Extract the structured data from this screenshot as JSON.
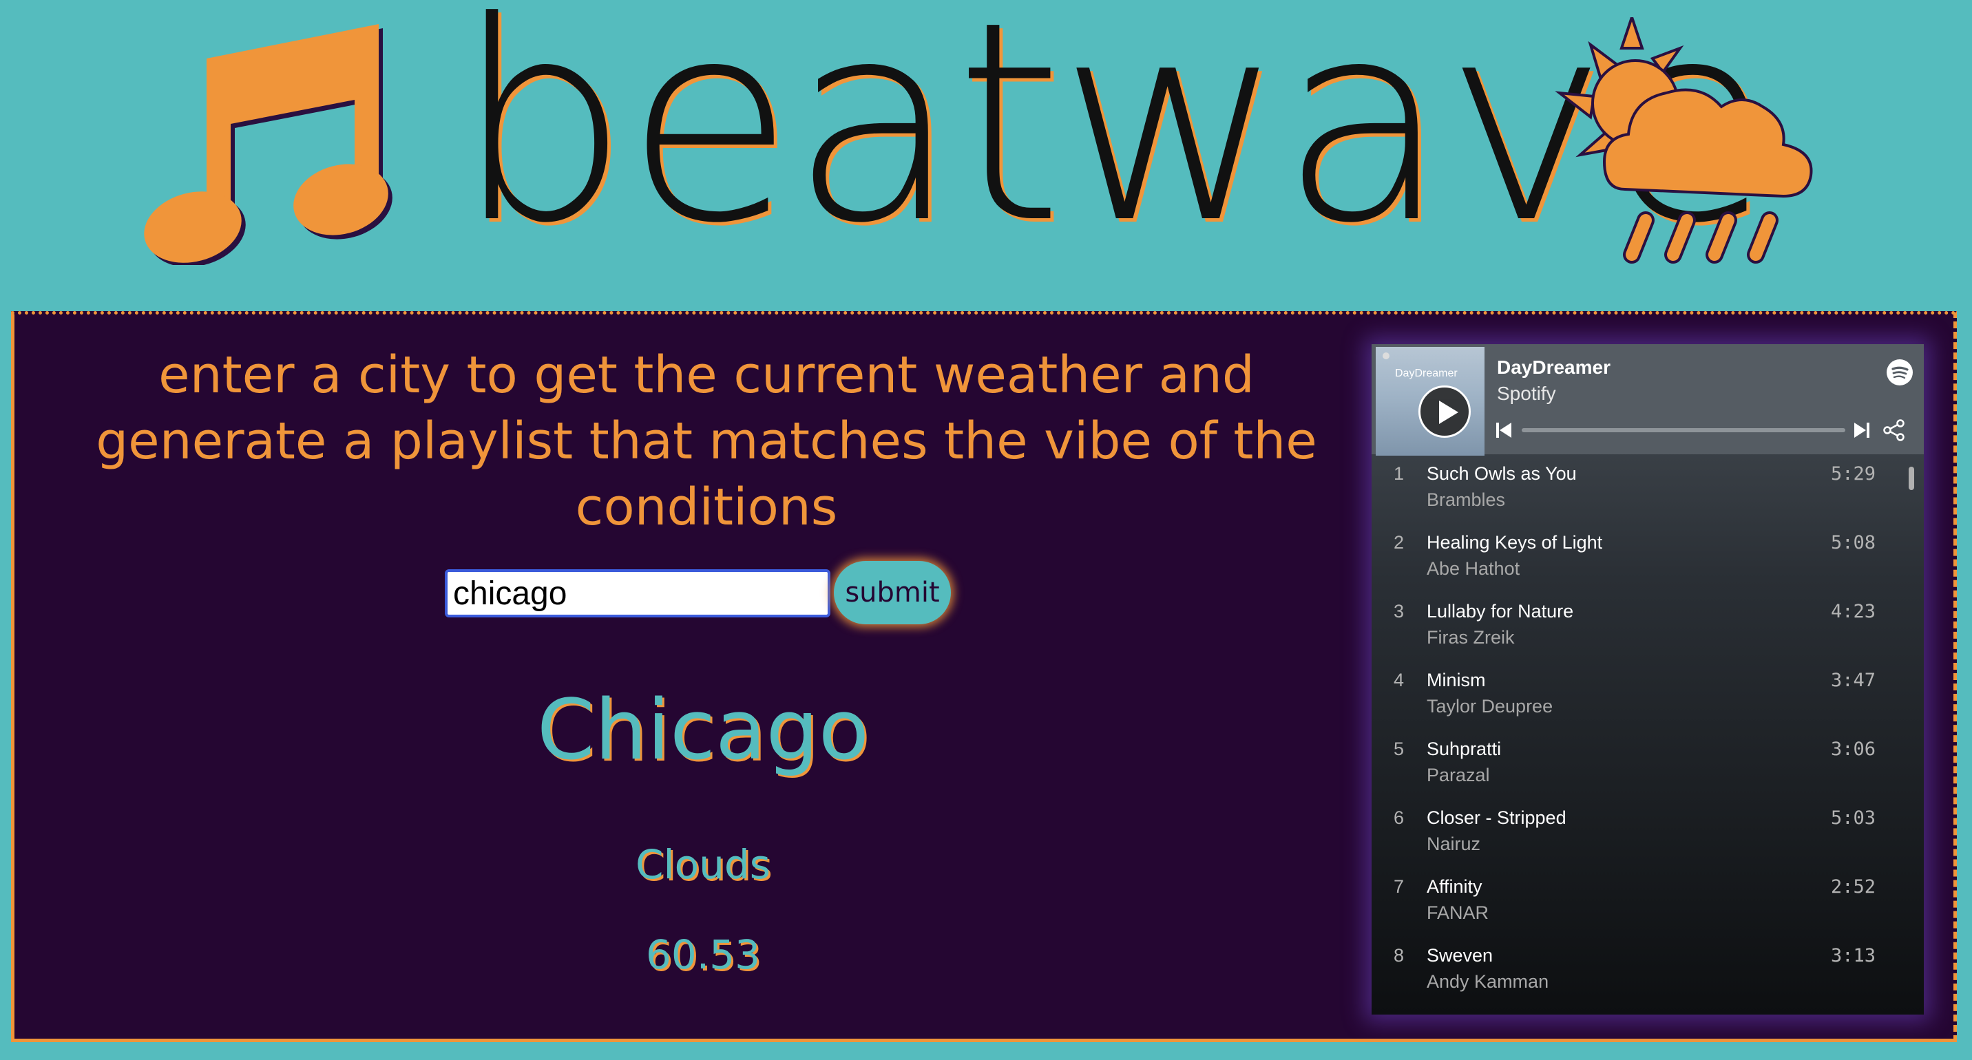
{
  "brand": {
    "name": "beatwave"
  },
  "icons": {
    "logo_left": "music-note-icon",
    "logo_right": "sun-cloud-rain-icon"
  },
  "colors": {
    "background": "#55bcbe",
    "accent": "#f0953a",
    "panel": "#250632",
    "weather_text": "#55bcbe"
  },
  "search": {
    "prompt": "enter a city to get the current weather and generate a playlist that matches the vibe of the conditions",
    "value": "chicago",
    "submit_label": "submit"
  },
  "weather": {
    "city": "Chicago",
    "condition": "Clouds",
    "temperature": "60.53"
  },
  "spotify": {
    "cover_text": "DayDreamer",
    "playlist_title": "DayDreamer",
    "owner": "Spotify",
    "tracks": [
      {
        "num": "1",
        "title": "Such Owls as You",
        "artist": "Brambles",
        "duration": "5:29"
      },
      {
        "num": "2",
        "title": "Healing Keys of Light",
        "artist": "Abe Hathot",
        "duration": "5:08"
      },
      {
        "num": "3",
        "title": "Lullaby for Nature",
        "artist": "Firas Zreik",
        "duration": "4:23"
      },
      {
        "num": "4",
        "title": "Minism",
        "artist": "Taylor Deupree",
        "duration": "3:47"
      },
      {
        "num": "5",
        "title": "Suhpratti",
        "artist": "Parazal",
        "duration": "3:06"
      },
      {
        "num": "6",
        "title": "Closer - Stripped",
        "artist": "Nairuz",
        "duration": "5:03"
      },
      {
        "num": "7",
        "title": "Affinity",
        "artist": "FANAR",
        "duration": "2:52"
      },
      {
        "num": "8",
        "title": "Sweven",
        "artist": "Andy Kamman",
        "duration": "3:13"
      }
    ]
  }
}
